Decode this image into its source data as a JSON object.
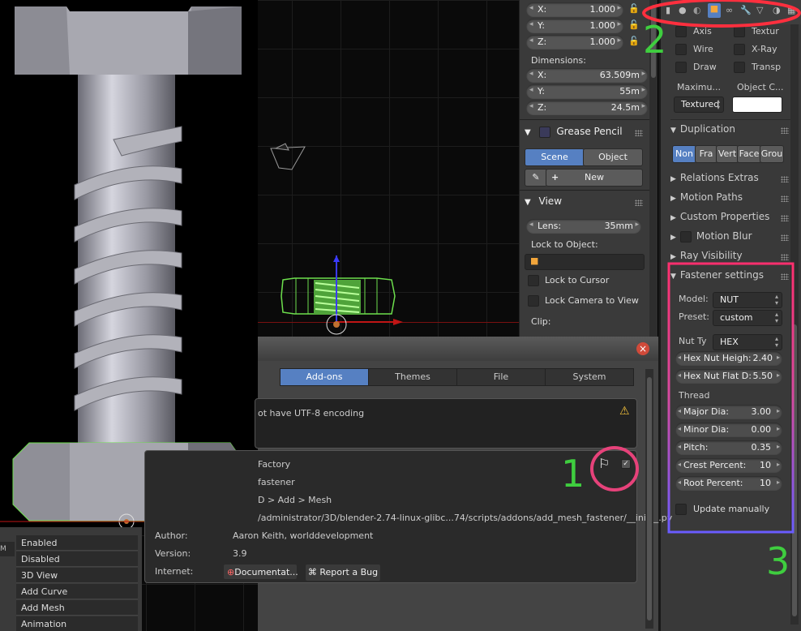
{
  "npanel": {
    "location": [
      {
        "axis": "X:",
        "value": "1.000"
      },
      {
        "axis": "Y:",
        "value": "1.000"
      },
      {
        "axis": "Z:",
        "value": "1.000"
      }
    ],
    "dimensions_label": "Dimensions:",
    "dimensions": [
      {
        "axis": "X:",
        "value": "63.509m"
      },
      {
        "axis": "Y:",
        "value": "55m"
      },
      {
        "axis": "Z:",
        "value": "24.5m"
      }
    ],
    "grease_pencil": {
      "title": "Grease Pencil",
      "tabs": [
        "Scene",
        "Object"
      ],
      "new_label": "New"
    },
    "view": {
      "title": "View",
      "lens_label": "Lens:",
      "lens_value": "35mm",
      "lock_to_object": "Lock to Object:",
      "lock_to_cursor": "Lock to Cursor",
      "lock_camera": "Lock Camera to View",
      "clip": "Clip:"
    }
  },
  "props": {
    "header_icons": [
      "render-icon",
      "scene-icon",
      "world-icon",
      "object-icon",
      "constraints-icon",
      "modifiers-icon",
      "data-icon",
      "material-icon",
      "texture-icon"
    ],
    "display_checks": [
      {
        "left": "Axis",
        "right": "Textur"
      },
      {
        "left": "Wire",
        "right": "X-Ray"
      },
      {
        "left": "Draw",
        "right": "Transp"
      }
    ],
    "maximum_label": "Maximu...",
    "object_color_label": "Object C...",
    "draw_type": "Textured",
    "duplication": {
      "title": "Duplication",
      "options": [
        "Non",
        "Fra",
        "Vert",
        "Face",
        "Grou"
      ]
    },
    "sections": [
      "Relations Extras",
      "Motion Paths",
      "Custom Properties",
      "Motion Blur",
      "Ray Visibility"
    ],
    "fastener": {
      "title": "Fastener settings",
      "model_label": "Model:",
      "model_value": "NUT",
      "preset_label": "Preset:",
      "preset_value": "custom",
      "nut_type_label": "Nut Ty",
      "nut_type_value": "HEX",
      "hex_height": {
        "label": "Hex Nut Heigh:",
        "value": "2.40"
      },
      "hex_flat": {
        "label": "Hex Nut Flat D:",
        "value": "5.50"
      },
      "thread_label": "Thread",
      "thread_fields": [
        {
          "label": "Major Dia:",
          "value": "3.00"
        },
        {
          "label": "Minor Dia:",
          "value": "0.00"
        },
        {
          "label": "Pitch:",
          "value": "0.35"
        },
        {
          "label": "Crest Percent:",
          "value": "10"
        },
        {
          "label": "Root Percent:",
          "value": "10"
        }
      ],
      "update_manually": "Update manually"
    }
  },
  "prefs": {
    "tabs": [
      "Add-ons",
      "Themes",
      "File",
      "System"
    ],
    "warning": "ot have UTF-8 encoding",
    "addon": {
      "name": "Factory",
      "desc": "fastener",
      "location": "D > Add > Mesh",
      "file": "/administrator/3D/blender-2.74-linux-glibc...74/scripts/addons/add_mesh_fastener/__init__.py",
      "author_label": "Author:",
      "author": "Aaron Keith, worlddevelopment",
      "version_label": "Version:",
      "version": "3.9",
      "internet_label": "Internet:",
      "doc_button": "Documentat...",
      "bug_button": "Report a Bug"
    }
  },
  "addon_list": [
    "Enabled",
    "Disabled",
    "3D View",
    "Add Curve",
    "Add Mesh",
    "Animation"
  ],
  "annotations": [
    "1",
    "2",
    "3"
  ],
  "colors": {
    "accent_blue": "#5680c2",
    "annotation_green": "#3fce3f",
    "circle_magenta": "#e6427a"
  }
}
